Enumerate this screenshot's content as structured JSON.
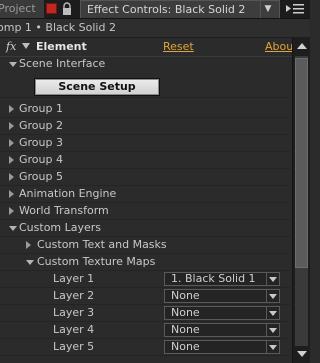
{
  "tabs": {
    "project_label": "Project",
    "active_label": "Effect Controls: Black Solid 2"
  },
  "breadcrumb": "omp 1 • Black Solid 2",
  "effect": {
    "fx_label": "fx",
    "name": "Element",
    "reset_label": "Reset",
    "about_label": "Abou"
  },
  "scene_interface": {
    "label": "Scene Interface",
    "button_label": "Scene Setup"
  },
  "groups": [
    "Group 1",
    "Group 2",
    "Group 3",
    "Group 4",
    "Group 5"
  ],
  "sections": {
    "animation_engine": "Animation Engine",
    "world_transform": "World Transform",
    "custom_layers": "Custom Layers",
    "custom_text_masks": "Custom Text and Masks",
    "custom_texture_maps": "Custom Texture Maps"
  },
  "layers": [
    {
      "label": "Layer 1",
      "value": "1. Black Solid 1"
    },
    {
      "label": "Layer 2",
      "value": "None"
    },
    {
      "label": "Layer 3",
      "value": "None"
    },
    {
      "label": "Layer 4",
      "value": "None"
    },
    {
      "label": "Layer 5",
      "value": "None"
    }
  ],
  "colors": {
    "background": "#2b2b2b",
    "link": "#e0a43a",
    "close_tab": "#c0271f"
  }
}
